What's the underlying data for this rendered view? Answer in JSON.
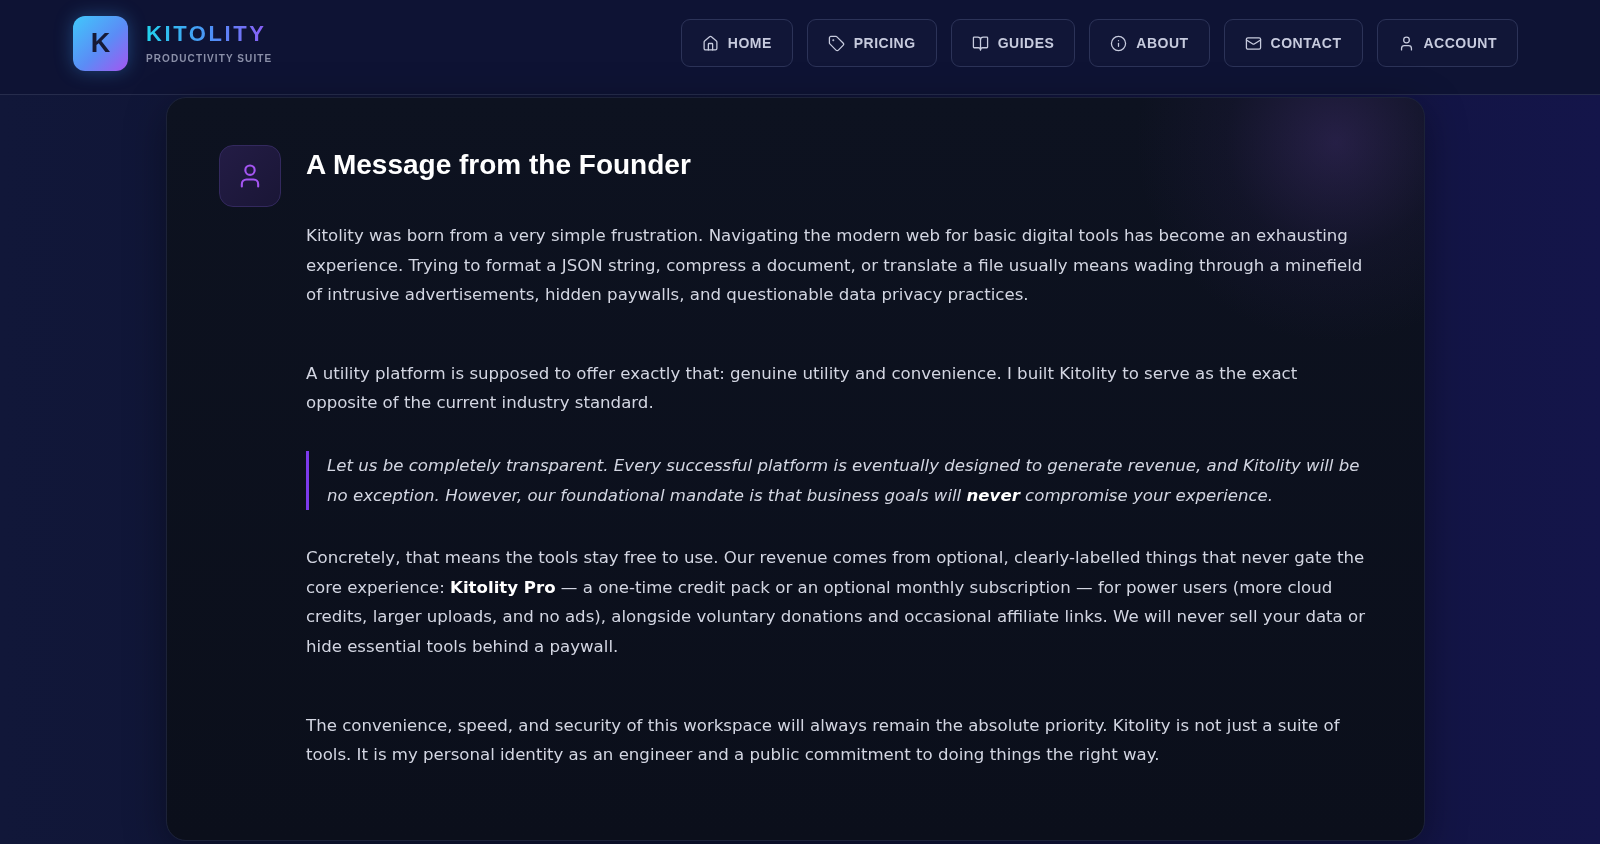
{
  "header": {
    "logo": {
      "letter": "K"
    },
    "brand": "KITOLITY",
    "tagline": "PRODUCTIVITY SUITE",
    "nav": [
      {
        "label": "HOME"
      },
      {
        "label": "PRICING"
      },
      {
        "label": "GUIDES"
      },
      {
        "label": "ABOUT"
      },
      {
        "label": "CONTACT"
      },
      {
        "label": "ACCOUNT"
      }
    ]
  },
  "card": {
    "title": "A Message from the Founder",
    "blocks": [
      {
        "kind": "paragraph",
        "text": "Kitolity was born from a very simple frustration. Navigating the modern web for basic digital tools has become an exhausting experience. Trying to format a JSON string, compress a document, or translate a file usually means wading through a minefield of intrusive advertisements, hidden paywalls, and questionable data privacy practices."
      },
      {
        "kind": "paragraph",
        "text": "A utility platform is supposed to offer exactly that: genuine utility and convenience. I built Kitolity to serve as the exact opposite of the current industry standard."
      },
      {
        "kind": "quote",
        "text": "Let us be completely transparent. Every successful platform is eventually designed to generate revenue, and Kitolity will be no exception. However, our foundational mandate is that business goals will **never** compromise your experience."
      },
      {
        "kind": "paragraph",
        "text": "Concretely, that means the tools stay free to use. Our revenue comes from optional, clearly-labelled things that never gate the core experience: **Kitolity Pro** — a one-time credit pack or an optional monthly subscription — for power users (more cloud credits, larger uploads, and no ads), alongside voluntary donations and occasional affiliate links. We will never sell your data or hide essential tools behind a paywall."
      },
      {
        "kind": "paragraph",
        "text": "The convenience, speed, and security of this workspace will always remain the absolute priority. Kitolity is not just a suite of tools. It is my personal identity as an engineer and a public commitment to doing things the right way."
      }
    ]
  }
}
